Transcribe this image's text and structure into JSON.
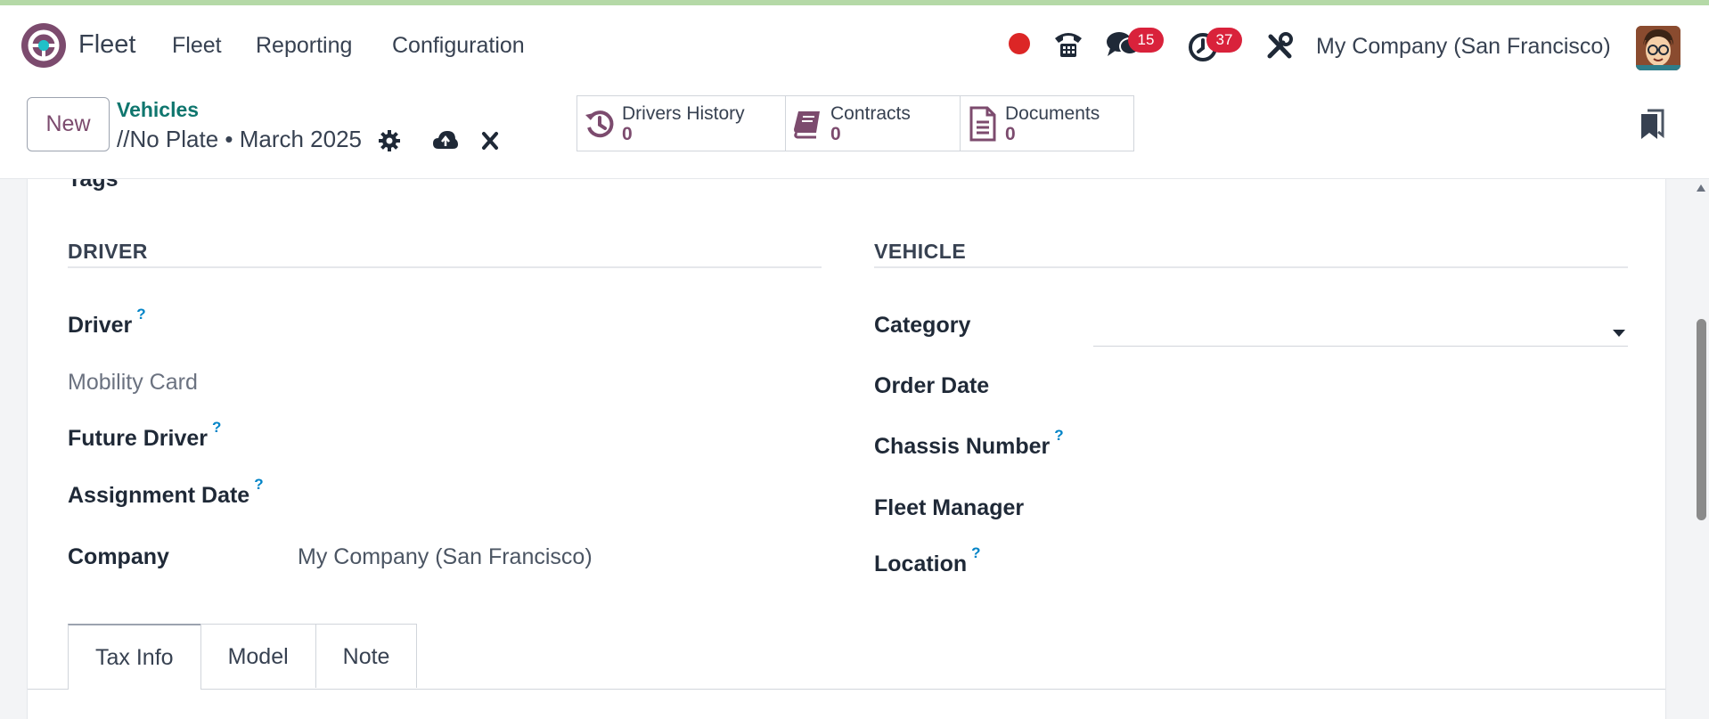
{
  "navbar": {
    "app_name": "Fleet",
    "menus": [
      "Fleet",
      "Reporting",
      "Configuration"
    ],
    "messages_badge": "15",
    "activities_badge": "37",
    "company": "My Company (San Francisco)"
  },
  "control_panel": {
    "new_label": "New",
    "breadcrumb_parent": "Vehicles",
    "breadcrumb_current": "//No Plate • March 2025",
    "stats": [
      {
        "label": "Drivers History",
        "value": "0"
      },
      {
        "label": "Contracts",
        "value": "0"
      },
      {
        "label": "Documents",
        "value": "0"
      }
    ]
  },
  "form": {
    "tags_label": "Tags",
    "driver_section": {
      "title": "DRIVER",
      "driver_label": "Driver",
      "mobility_card_label": "Mobility Card",
      "future_driver_label": "Future Driver",
      "assignment_date_label": "Assignment Date",
      "company_label": "Company",
      "company_value": "My Company (San Francisco)"
    },
    "vehicle_section": {
      "title": "VEHICLE",
      "category_label": "Category",
      "order_date_label": "Order Date",
      "chassis_number_label": "Chassis Number",
      "fleet_manager_label": "Fleet Manager",
      "location_label": "Location"
    },
    "help_mark": "?",
    "tabs": [
      "Tax Info",
      "Model",
      "Note"
    ]
  },
  "colors": {
    "brand": "#7c4b6e",
    "link": "#0f766e",
    "badge": "#d9223b",
    "recording_dot": "#dc2626"
  }
}
